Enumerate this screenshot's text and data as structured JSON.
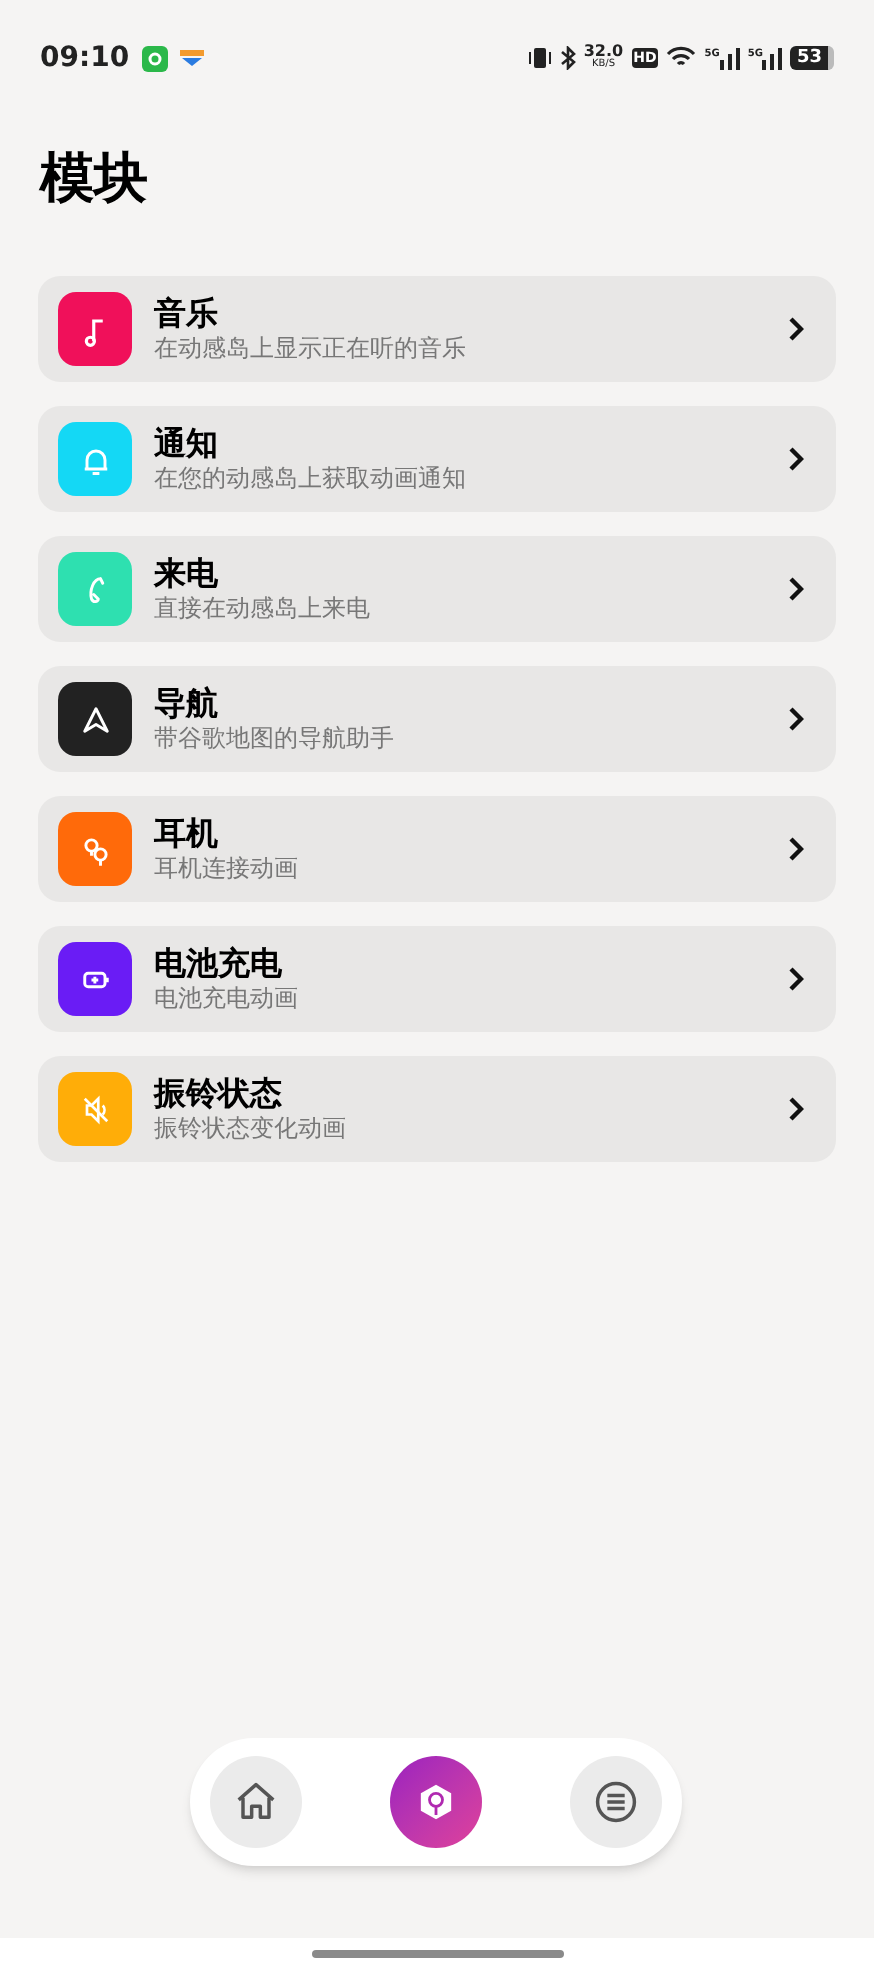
{
  "status_bar": {
    "time": "09:10",
    "net_speed": "32.0",
    "net_unit": "KB/S",
    "hd": "HD",
    "sim1": "5G",
    "sim2": "5G",
    "battery": "53"
  },
  "title": "模块",
  "modules": [
    {
      "kind": "music",
      "title": "音乐",
      "subtitle": "在动感岛上显示正在听的音乐",
      "color": "#f0105a"
    },
    {
      "kind": "notification",
      "title": "通知",
      "subtitle": "在您的动感岛上获取动画通知",
      "color": "#14d8f5"
    },
    {
      "kind": "call",
      "title": "来电",
      "subtitle": "直接在动感岛上来电",
      "color": "#2ee0b0"
    },
    {
      "kind": "navigation",
      "title": "导航",
      "subtitle": "带谷歌地图的导航助手",
      "color": "#222222"
    },
    {
      "kind": "earphones",
      "title": "耳机",
      "subtitle": "耳机连接动画",
      "color": "#ff6a0a"
    },
    {
      "kind": "battery",
      "title": "电池充电",
      "subtitle": "电池充电动画",
      "color": "#6a1cf5"
    },
    {
      "kind": "ringer",
      "title": "振铃状态",
      "subtitle": "振铃状态变化动画",
      "color": "#ffad08"
    }
  ],
  "bottom_nav": [
    {
      "kind": "home",
      "selected": false
    },
    {
      "kind": "modules",
      "selected": true
    },
    {
      "kind": "menu",
      "selected": false
    }
  ]
}
